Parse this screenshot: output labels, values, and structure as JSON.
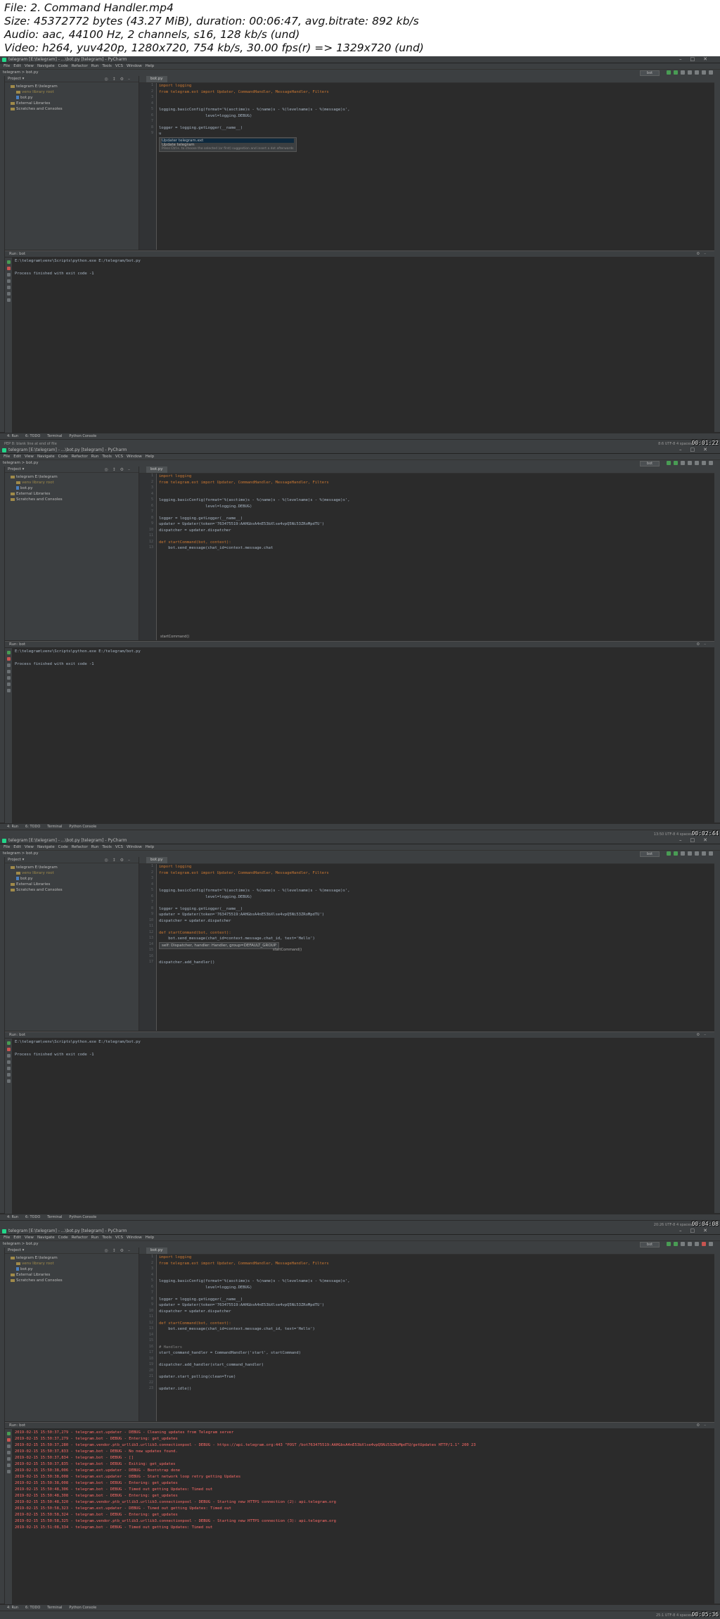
{
  "header": {
    "line1": "File: 2. Command Handler.mp4",
    "line2": "Size: 45372772 bytes (43.27 MiB), duration: 00:06:47, avg.bitrate: 892 kb/s",
    "line3": "Audio: aac, 44100 Hz, 2 channels, s16, 128 kb/s (und)",
    "line4": "Video: h264, yuv420p, 1280x720, 754 kb/s, 30.00 fps(r) => 1329x720 (und)"
  },
  "ide": {
    "title": "telegram [E:\\telegram] - ...\\bot.py [telegram] - PyCharm",
    "menu": [
      "File",
      "Edit",
      "View",
      "Navigate",
      "Code",
      "Refactor",
      "Run",
      "Tools",
      "VCS",
      "Window",
      "Help"
    ],
    "crumb": "telegram > bot.py",
    "run_config": "bot",
    "tab": "bot.py",
    "project_label": "Project",
    "tree": [
      {
        "label": "telegram  E:\\telegram",
        "kind": "folder"
      },
      {
        "label": "venv  library root",
        "kind": "venv"
      },
      {
        "label": "bot.py",
        "kind": "file"
      },
      {
        "label": "External Libraries",
        "kind": "folder"
      },
      {
        "label": "Scratches and Consoles",
        "kind": "folder"
      }
    ],
    "run_tab": "Run:",
    "run_name": "bot",
    "run_cmd": "E:\\telegram\\venv\\Scripts\\python.exe E:/telegram/bot.py",
    "run_exit": "Process finished with exit code -1",
    "toolwindows": [
      "4: Run",
      "6: TODO",
      "Terminal",
      "Python Console"
    ],
    "status_left": "PEP 8: blank line at end of file",
    "status_right": "UTF-8  4 spaces"
  },
  "frames": [
    {
      "timestamp": "00:01:22",
      "status_pos": "8:6",
      "code": [
        "import logging",
        "from telegram.ext import Updater, CommandHandler, MessageHandler, Filters",
        "",
        "",
        "logging.basicConfig(format='%(asctime)s - %(name)s - %(levelname)s - %(message)s',",
        "                    level=logging.DEBUG)",
        "",
        "logger = logging.getLogger(__name__)",
        "u"
      ],
      "popup": [
        "Updater        telegram.ext",
        "Update         telegram",
        "Press Ctrl+. to choose the selected (or first) suggestion and insert a dot afterwards"
      ]
    },
    {
      "timestamp": "00:02:44",
      "status_pos": "13:50",
      "code": [
        "import logging",
        "from telegram.ext import Updater, CommandHandler, MessageHandler, Filters",
        "",
        "",
        "logging.basicConfig(format='%(asctime)s - %(name)s - %(levelname)s - %(message)s',",
        "                    level=logging.DEBUG)",
        "",
        "logger = logging.getLogger(__name__)",
        "updater = Updater(token='763475519:AAHGbsA4nE53bXlse4vpQ5Ni53ZRoMpdTU')",
        "dispatcher = updater.dispatcher",
        "",
        "def startCommand(bot, context):",
        "    bot.send_message(chat_id=context.message.chat"
      ],
      "footer_hint": "startCommand()"
    },
    {
      "timestamp": "00:04:08",
      "status_pos": "20:26",
      "code": [
        "import logging",
        "from telegram.ext import Updater, CommandHandler, MessageHandler, Filters",
        "",
        "",
        "logging.basicConfig(format='%(asctime)s - %(name)s - %(levelname)s - %(message)s',",
        "                    level=logging.DEBUG)",
        "",
        "logger = logging.getLogger(__name__)",
        "updater = Updater(token='763475519:AAHGbsA4nE53bXlse4vpQ5Ni53ZRoMpdTU')",
        "dispatcher = updater.dispatcher",
        "",
        "def startCommand(bot, context):",
        "    bot.send_message(chat_id=context.message.chat_id, text='Hello')",
        "",
        "",
        "",
        "dispatcher.add_handler()"
      ],
      "popup": [
        "self: Dispatcher, handler: Handler, group=DEFAULT_GROUP"
      ],
      "hint_right": "startCommand()"
    },
    {
      "timestamp": "00:05:36",
      "status_pos": "25:1",
      "code": [
        "import logging",
        "from telegram.ext import Updater, CommandHandler, MessageHandler, Filters",
        "",
        "",
        "logging.basicConfig(format='%(asctime)s - %(name)s - %(levelname)s - %(message)s',",
        "                    level=logging.DEBUG)",
        "",
        "logger = logging.getLogger(__name__)",
        "updater = Updater(token='763475519:AAHGbsA4nE53bXlse4vpQ5Ni53ZRoMpdTU')",
        "dispatcher = updater.dispatcher",
        "",
        "def startCommand(bot, context):",
        "    bot.send_message(chat_id=context.message.chat_id, text='Hello')",
        "",
        "",
        "# Handlers",
        "start_command_handler = CommandHandler('start', startCommand)",
        "",
        "dispatcher.add_handler(start_command_handler)",
        "",
        "updater.start_polling(clean=True)",
        "",
        "updater.idle()"
      ],
      "log": [
        "2019-02-15 15:50:37,279 - telegram.ext.updater - DEBUG - Cleaning updates from Telegram server",
        "2019-02-15 15:50:37,279 - telegram.bot - DEBUG - Entering: get_updates",
        "2019-02-15 15:50:37,280 - telegram.vendor.ptb_urllib3.urllib3.connectionpool - DEBUG - https://api.telegram.org:443 \"POST /bot763475519:AAHGbsA4nE53bXlse4vpQ5Ni53ZRoMpdTU/getUpdates HTTP/1.1\" 200 23",
        "2019-02-15 15:50:37,833 - telegram.bot - DEBUG - No new updates found.",
        "2019-02-15 15:50:37,834 - telegram.bot - DEBUG - []",
        "2019-02-15 15:50:37,835 - telegram.bot - DEBUG - Exiting: get_updates",
        "2019-02-15 15:50:38,006 - telegram.ext.updater - DEBUG - Bootstrap done",
        "2019-02-15 15:50:38,008 - telegram.ext.updater - DEBUG - Start network loop retry getting Updates",
        "2019-02-15 15:50:38,008 - telegram.bot - DEBUG - Entering: get_updates",
        "2019-02-15 15:50:48,306 - telegram.bot - DEBUG - Timed out getting Updates: Timed out",
        "2019-02-15 15:50:48,308 - telegram.bot - DEBUG - Entering: get_updates",
        "2019-02-15 15:50:48,320 - telegram.vendor.ptb_urllib3.urllib3.connectionpool - DEBUG - Starting new HTTPS connection (2): api.telegram.org",
        "2019-02-15 15:50:58,323 - telegram.ext.updater - DEBUG - Timed out getting Updates: Timed out",
        "2019-02-15 15:50:58,324 - telegram.bot - DEBUG - Entering: get_updates",
        "2019-02-15 15:50:58,325 - telegram.vendor.ptb_urllib3.urllib3.connectionpool - DEBUG - Starting new HTTPS connection (3): api.telegram.org",
        "2019-02-15 15:51:08,334 - telegram.bot - DEBUG - Timed out getting Updates: Timed out"
      ]
    }
  ]
}
